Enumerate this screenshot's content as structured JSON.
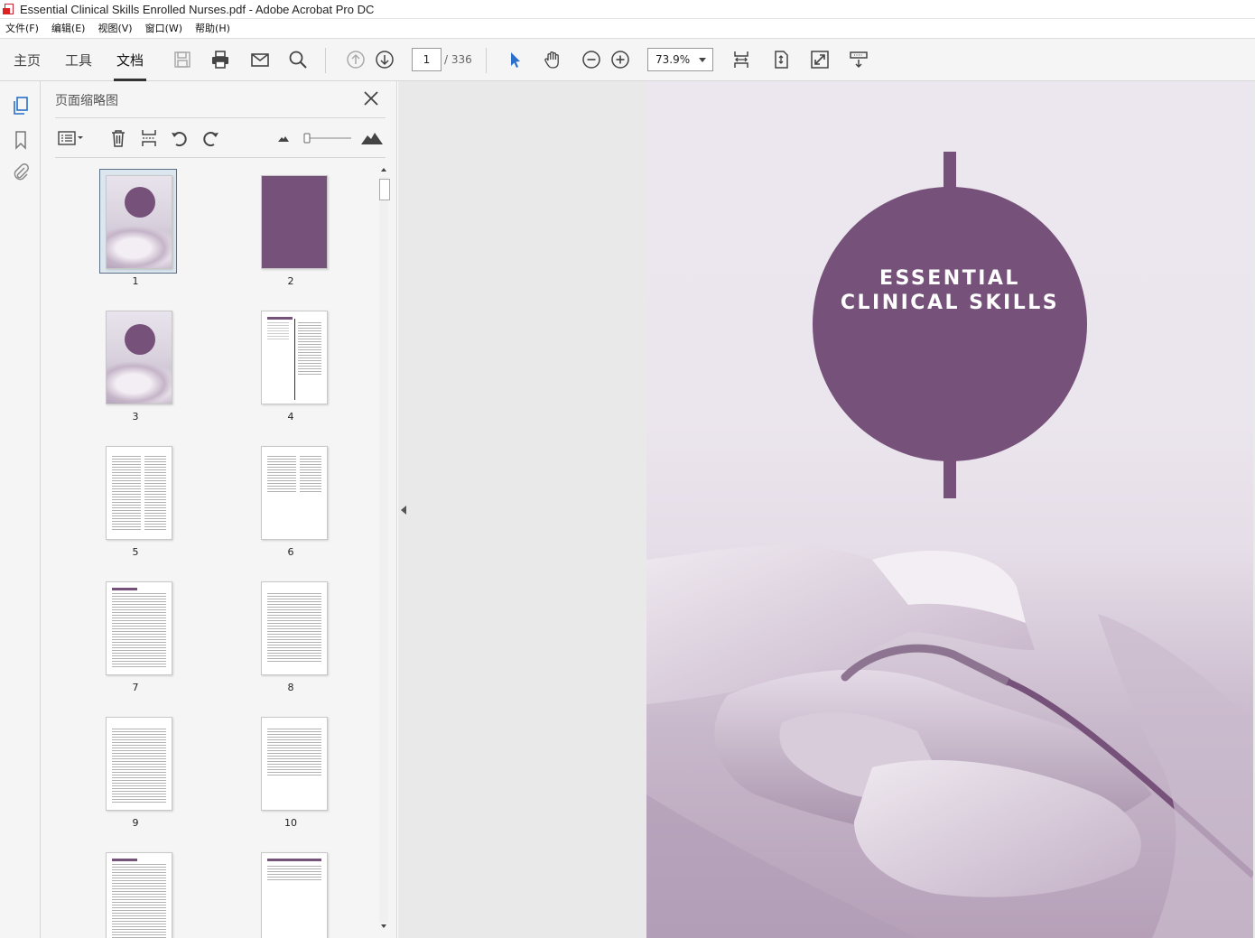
{
  "window": {
    "title": "Essential Clinical Skills Enrolled Nurses.pdf - Adobe Acrobat Pro DC"
  },
  "menu": [
    "文件(F)",
    "编辑(E)",
    "视图(V)",
    "窗口(W)",
    "帮助(H)"
  ],
  "tabs": {
    "home": "主页",
    "tools": "工具",
    "document": "文档"
  },
  "navigation": {
    "current_page": "1",
    "total_pages": "/ 336",
    "zoom": "73.9%"
  },
  "panel": {
    "title": "页面缩略图",
    "thumbnails": [
      "1",
      "2",
      "3",
      "4",
      "5",
      "6",
      "7",
      "8",
      "9",
      "10"
    ]
  },
  "cover": {
    "line1": "ESSENTIAL",
    "line2": "CLINICAL SKILLS",
    "accent_color": "#76517a"
  }
}
